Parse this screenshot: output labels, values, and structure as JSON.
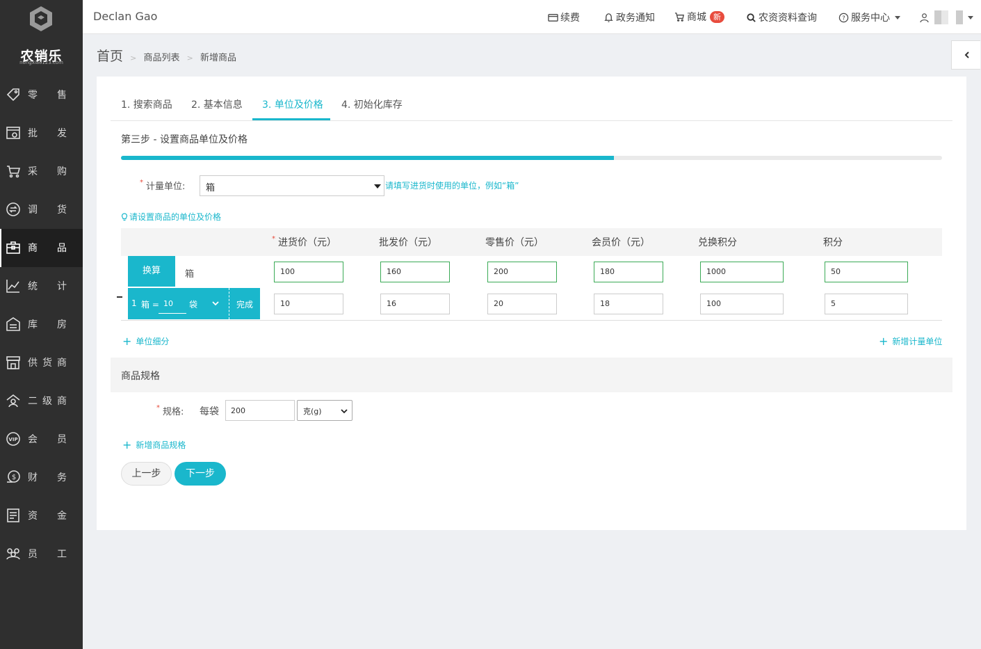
{
  "sidebar": {
    "brand": "农销乐",
    "brand_sub": "nongxiao123.com",
    "items": [
      {
        "label": "零售",
        "icon": "tag-icon"
      },
      {
        "label": "批发",
        "icon": "wholesale-icon"
      },
      {
        "label": "采购",
        "icon": "cart-icon"
      },
      {
        "label": "调货",
        "icon": "transfer-icon"
      },
      {
        "label": "商品",
        "icon": "goods-icon",
        "active": true
      },
      {
        "label": "统计",
        "icon": "chart-icon"
      },
      {
        "label": "库房",
        "icon": "warehouse-icon"
      },
      {
        "label": "供货商",
        "icon": "store-icon"
      },
      {
        "label": "二级商",
        "icon": "dealer-icon"
      },
      {
        "label": "会员",
        "icon": "vip-icon"
      },
      {
        "label": "财务",
        "icon": "finance-icon"
      },
      {
        "label": "资金",
        "icon": "ledger-icon"
      },
      {
        "label": "员工",
        "icon": "staff-icon"
      }
    ]
  },
  "topbar": {
    "user": "Declan Gao",
    "renew": "续费",
    "notice": "政务通知",
    "mall": "商城",
    "mall_badge": "新",
    "search": "农资资料查询",
    "service": "服务中心"
  },
  "breadcrumb": {
    "home": "首页",
    "list": "商品列表",
    "current": "新增商品"
  },
  "tabs": [
    "1. 搜索商品",
    "2. 基本信息",
    "3. 单位及价格",
    "4. 初始化库存"
  ],
  "active_tab": 2,
  "step_title": "第三步 - 设置商品单位及价格",
  "progress": 0.6,
  "unit": {
    "label": "计量单位:",
    "value": "箱",
    "hint": "请填写进货时使用的单位，例如“箱”"
  },
  "price_tip": "请设置商品的单位及价格",
  "table": {
    "headers": [
      "进货价（元）",
      "批发价（元）",
      "零售价（元）",
      "会员价（元）",
      "兑换积分",
      "积分"
    ],
    "convert_label": "换算",
    "base_unit": "箱",
    "base_values": [
      "100",
      "160",
      "200",
      "180",
      "1000",
      "50"
    ],
    "sub": {
      "qty_left": "1",
      "unit_left": "箱 =",
      "qty_right": "10",
      "unit_right": "袋",
      "done": "完成",
      "values": [
        "10",
        "16",
        "20",
        "18",
        "100",
        "5"
      ]
    }
  },
  "links": {
    "subdivide": "单位细分",
    "add_unit": "新增计量单位",
    "add_spec": "新增商品规格"
  },
  "spec": {
    "heading": "商品规格",
    "label": "规格:",
    "prefix": "每袋",
    "qty": "200",
    "unit": "克(g)"
  },
  "buttons": {
    "prev": "上一步",
    "next": "下一步"
  },
  "colors": {
    "accent": "#1ab7cc",
    "sidebar": "#2f2f2f",
    "valid_border": "#3aaa55",
    "badge": "#e84c3d"
  }
}
